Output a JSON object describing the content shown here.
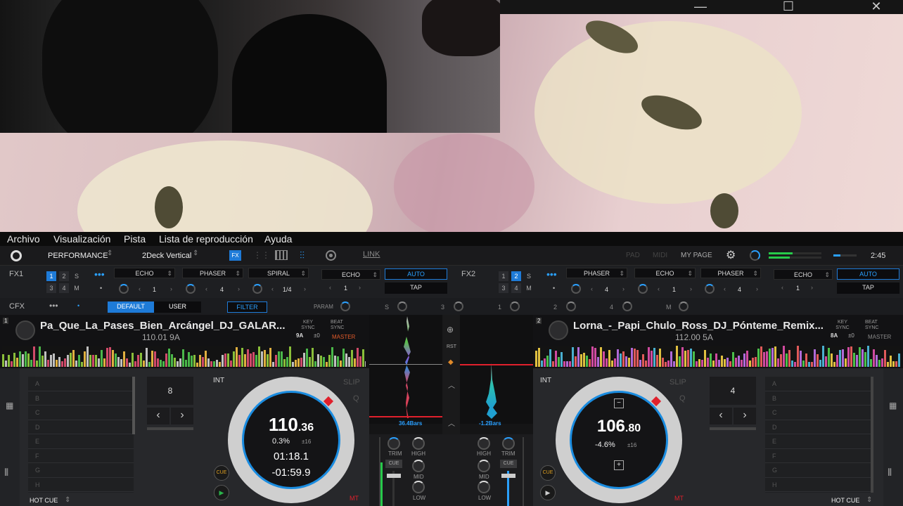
{
  "window": {
    "minimize": "—",
    "maximize": "☐",
    "close": "✕"
  },
  "menu": [
    "Archivo",
    "Visualización",
    "Pista",
    "Lista de reproducción",
    "Ayuda"
  ],
  "toolbar": {
    "layout": "PERFORMANCE",
    "decks": "2Deck Vertical",
    "fx": "FX",
    "link": "LINK",
    "pad": "PAD",
    "midi": "MIDI",
    "mypage": "MY PAGE",
    "time": "2:45"
  },
  "fx1": {
    "label": "FX1",
    "slots": [
      "ECHO",
      "PHASER",
      "SPIRAL",
      "ECHO"
    ],
    "values": [
      "1",
      "4",
      "1/4",
      "1"
    ],
    "auto": "AUTO",
    "tap": "TAP"
  },
  "fx2": {
    "label": "FX2",
    "slots": [
      "PHASER",
      "ECHO",
      "PHASER",
      "ECHO"
    ],
    "values": [
      "4",
      "1",
      "4",
      "1"
    ],
    "auto": "AUTO",
    "tap": "TAP"
  },
  "fx_buttons": [
    "1",
    "2",
    "S",
    "3",
    "4",
    "M"
  ],
  "cfx": {
    "label": "CFX",
    "default": "DEFAULT",
    "user": "USER",
    "filter": "FILTER",
    "param": "PARAM",
    "knobs": [
      "S",
      "3",
      "1",
      "2",
      "4",
      "M"
    ]
  },
  "deck1": {
    "num": "1",
    "title": "Pa_Que_La_Pases_Bien_Arcángel_DJ_GALAR...",
    "bpm_key": "110.01  9A",
    "keysync": "KEY\nSYNC",
    "key": "9A",
    "keyoff": "±0",
    "beatsync": "BEAT\nSYNC",
    "master": "MASTER",
    "loop": "8",
    "int": "INT",
    "slip": "SLIP",
    "q": "Q",
    "bpm_main": "110",
    "bpm_dec": ".36",
    "pitch": "0.3%",
    "range": "±16",
    "elapsed": "01:18.1",
    "remain": "-01:59.9",
    "cue": "CUE",
    "mt": "MT",
    "hotcue": "HOT CUE",
    "pads": [
      "A",
      "B",
      "C",
      "D",
      "E",
      "F",
      "G",
      "H"
    ]
  },
  "deck2": {
    "num": "2",
    "title": "Lorna_-_Papi_Chulo_Ross_DJ_Pónteme_Remix...",
    "bpm_key": "112.00  5A",
    "keysync": "KEY\nSYNC",
    "key": "8A",
    "keyoff": "±0",
    "beatsync": "BEAT\nSYNC",
    "master": "MASTER",
    "loop": "4",
    "int": "INT",
    "slip": "SLIP",
    "q": "Q",
    "bpm_main": "106",
    "bpm_dec": ".80",
    "pitch": "-4.6%",
    "range": "±16",
    "cue": "CUE",
    "mt": "MT",
    "hotcue": "HOT CUE",
    "pads": [
      "A",
      "B",
      "C",
      "D",
      "E",
      "F",
      "G",
      "H"
    ]
  },
  "mixer": {
    "rst": "RST",
    "bars_left": "36.4Bars",
    "bars_right": "-1.2Bars",
    "trim": "TRIM",
    "high": "HIGH",
    "mid": "MID",
    "low": "LOW",
    "cue": "CUE"
  },
  "colors": {
    "accent": "#1e7bd8",
    "master": "#e05a2a",
    "jogring": "#1a8ce0"
  }
}
